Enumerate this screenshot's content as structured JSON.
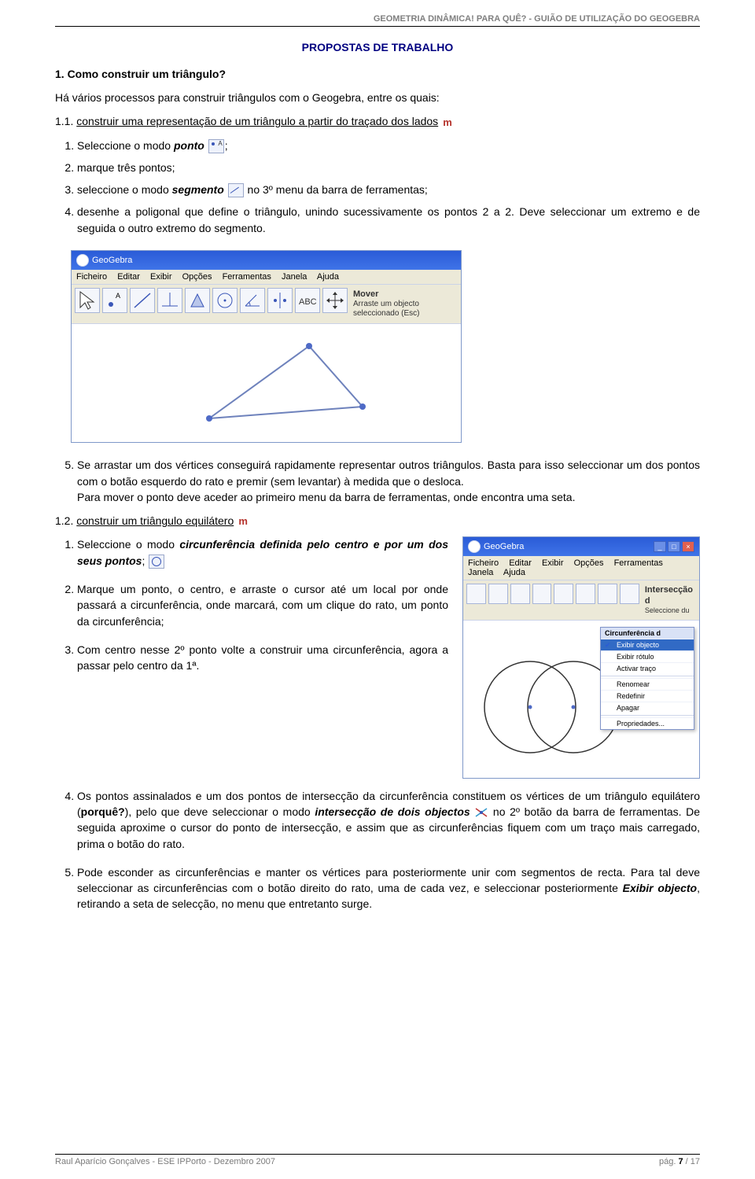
{
  "running_head": "GEOMETRIA DINÂMICA! PARA QUÊ?  -  GUIÃO DE UTILIZAÇÃO DO GEOGEBRA",
  "section_title": "PROPOSTAS DE TRABALHO",
  "q1": {
    "heading": "1. Como construir um triângulo?",
    "intro": "Há vários processos para construir triângulos com o Geogebra, entre os quais:",
    "sub11_prefix": "1.1. ",
    "sub11_link": "construir uma representação de um triângulo a partir do traçado dos lados",
    "steps": {
      "s1_a": "Seleccione o modo ",
      "s1_b": "ponto",
      "s1_c": ";",
      "s2": "marque três pontos;",
      "s3_a": "seleccione o modo ",
      "s3_b": "segmento",
      "s3_c": " no 3º menu da barra de ferramentas;",
      "s4": "desenhe a poligonal que define o triângulo, unindo sucessivamente os pontos 2 a 2. Deve seleccionar um extremo e de seguida o outro extremo do segmento.",
      "s5": "Se arrastar um dos vértices conseguirá rapidamente representar outros triângulos. Basta para isso seleccionar um dos pontos com o botão esquerdo do rato e premir (sem levantar) à medida que o desloca.",
      "s5_cont": "Para mover o ponto deve aceder ao primeiro menu da barra de ferramentas, onde encontra uma seta."
    },
    "fig1": {
      "app": "GeoGebra",
      "menus": [
        "Ficheiro",
        "Editar",
        "Exibir",
        "Opções",
        "Ferramentas",
        "Janela",
        "Ajuda"
      ],
      "help_title": "Mover",
      "help_text": "Arraste um objecto seleccionado (Esc)"
    },
    "sub12_prefix": "1.2. ",
    "sub12_link": "construir um triângulo equilátero",
    "steps2": {
      "s1_a": "Seleccione o modo ",
      "s1_b": "circunferência definida pelo centro e por um dos seus pontos",
      "s1_c": ";",
      "s2": "Marque um ponto, o centro, e arraste o cursor até um local por onde passará a circunferência, onde marcará, com um clique do rato, um ponto da circunferência;",
      "s3": "Com centro nesse 2º ponto volte a construir uma circunferência, agora a passar pelo centro da 1ª.",
      "s4_a": "Os pontos assinalados e um dos pontos de intersecção da circunferência constituem os vértices de um triângulo equilátero (",
      "s4_b": "porquê?",
      "s4_c": "), pelo que deve seleccionar o modo ",
      "s4_d": "intersecção de dois objectos",
      "s4_e": " no 2º botão da barra de ferramentas. De seguida aproxime o cursor do ponto de intersecção, e assim que as circunferências fiquem com um traço mais carregado, prima o botão do rato.",
      "s5_a": "Pode esconder as circunferências e manter os vértices para posteriormente unir com segmentos de recta. Para tal deve seleccionar as circunferências com o botão direito do rato, uma de cada vez, e seleccionar posteriormente ",
      "s5_b": "Exibir objecto",
      "s5_c": ", retirando a seta de selecção, no menu que entretanto surge."
    },
    "fig2": {
      "app": "GeoGebra",
      "titlebarExtra": "",
      "menus": [
        "Ficheiro",
        "Editar",
        "Exibir",
        "Opções",
        "Ferramentas",
        "Janela",
        "Ajuda"
      ],
      "help_title": "Intersecção d",
      "help_text": "Seleccione du",
      "ctx_header": "Circunferência d",
      "ctx_items": [
        "Exibir objecto",
        "Exibir rótulo",
        "Activar traço",
        "Renomear",
        "Redefinir",
        "Apagar",
        "Propriedades..."
      ]
    }
  },
  "footer": {
    "left": "Raul Aparício Gonçalves  -  ESE IPPorto - Dezembro 2007",
    "right_prefix": "pág. ",
    "page": "7",
    "total": " / 17"
  }
}
